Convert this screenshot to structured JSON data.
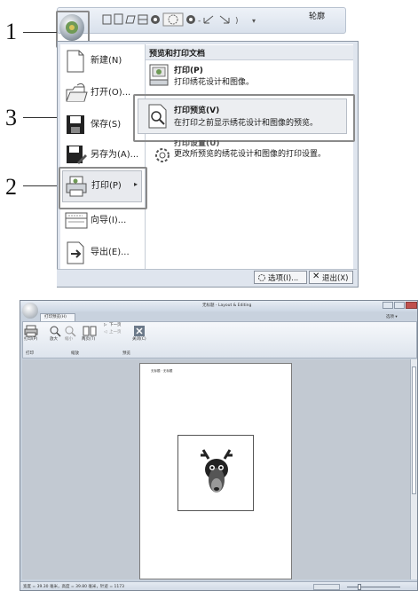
{
  "top": {
    "callouts": [
      "1",
      "2",
      "3"
    ],
    "qat_extra": "轮廓",
    "menu_left": [
      {
        "label": "新建(N)",
        "icon": "new-document-icon"
      },
      {
        "label": "打开(O)...",
        "icon": "open-folder-icon"
      },
      {
        "label": "保存(S)",
        "icon": "save-icon"
      },
      {
        "label": "另存为(A)...",
        "icon": "save-as-icon"
      },
      {
        "label": "打印(P)",
        "icon": "print-icon"
      },
      {
        "label": "向导(I)...",
        "icon": "wizard-icon"
      },
      {
        "label": "导出(E)...",
        "icon": "export-icon"
      }
    ],
    "submenu_header": "预览和打印文档",
    "submenu": [
      {
        "title": "打印(P)",
        "desc": "打印绣花设计和图像。"
      },
      {
        "title": "打印预览(V)",
        "desc": "在打印之前显示绣花设计和图像的预览。"
      },
      {
        "title": "打印设置(U)",
        "desc": "更改所预览的绣花设计和图像的打印设置。"
      }
    ],
    "options_button": "选项(I)...",
    "exit_button": "退出(X)"
  },
  "bottom": {
    "title": "无标题 - Layout & Editing",
    "tab": "打印预览(H)",
    "right_menu": "选项 ▾",
    "ribbon_buttons": [
      "打印(P)",
      "放大",
      "缩小",
      "两页(T)",
      "关闭(C)"
    ],
    "nav": [
      "下一页",
      "上一页"
    ],
    "groups": [
      "打印",
      "缩放",
      "预览"
    ],
    "page_header": "无标题 · 无标题",
    "status": "宽度 = 39.30 毫米，高度 = 39.80 毫米，针迹 = 1173"
  }
}
